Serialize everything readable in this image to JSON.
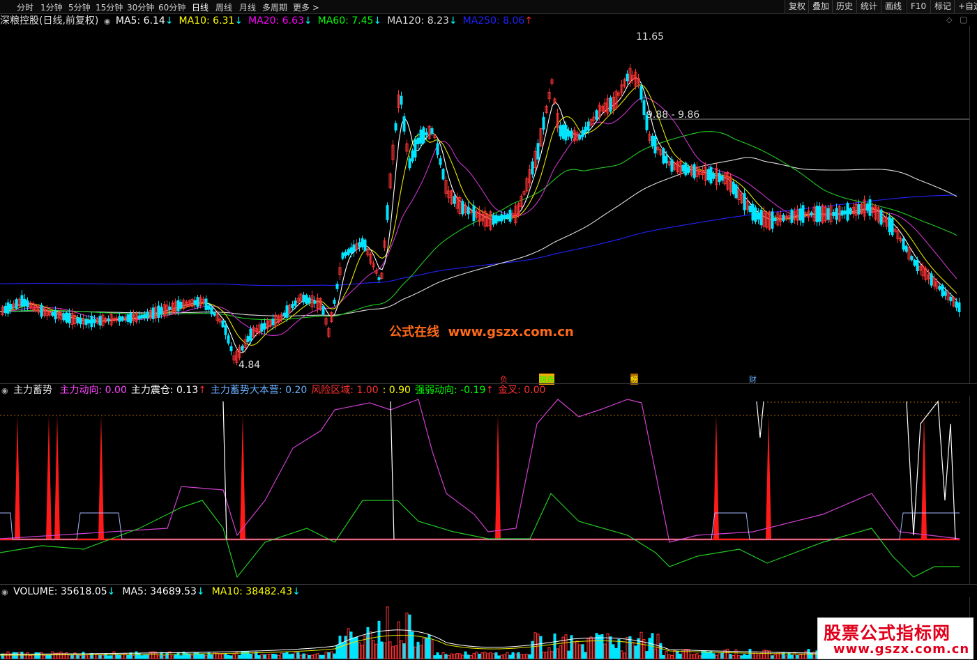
{
  "toolbar": {
    "timeframes": [
      "分时",
      "1分钟",
      "5分钟",
      "15分钟",
      "30分钟",
      "60分钟",
      "日线",
      "周线",
      "月线",
      "多周期",
      "更多 >"
    ],
    "active": "日线",
    "right_buttons": [
      "复权",
      "叠加",
      "历史",
      "统计",
      "画线",
      "F10",
      "标记",
      "+自选"
    ]
  },
  "main_panel": {
    "title": "深粮控股(日线,前复权)",
    "ma": [
      {
        "label": "MA5: 6.14",
        "arrow": "↓",
        "color": "#ffffff",
        "arrow_color": "#00ffff"
      },
      {
        "label": "MA10: 6.31",
        "arrow": "↓",
        "color": "#ffff00",
        "arrow_color": "#00ffff"
      },
      {
        "label": "MA20: 6.63",
        "arrow": "↓",
        "color": "#ff00ff",
        "arrow_color": "#00ffff"
      },
      {
        "label": "MA60: 7.45",
        "arrow": "↓",
        "color": "#00ff00",
        "arrow_color": "#00ffff"
      },
      {
        "label": "MA120: 8.23",
        "arrow": "↓",
        "color": "#dddddd",
        "arrow_color": "#00ffff"
      },
      {
        "label": "MA250: 8.06",
        "arrow": "↑",
        "color": "#2020ff",
        "arrow_color": "#ff3030"
      }
    ],
    "annotations": {
      "high": "11.65",
      "low": "4.84",
      "level": "9.88 - 9.86"
    },
    "watermark": "公式在线  www.gszx.com.cn",
    "event_markers": [
      {
        "text": "负",
        "color": "#ff3030"
      },
      {
        "text": "翅跌",
        "color": "#00ff00"
      },
      {
        "text": "榜",
        "color": "#ffff00"
      },
      {
        "text": "财",
        "color": "#6ab0ff"
      }
    ]
  },
  "indicator_panel": {
    "title": "主力蓄势",
    "items": [
      {
        "label": "主力动向: 0.00",
        "color": "#ff44ff"
      },
      {
        "label": "主力震仓: 0.13",
        "color": "#ffffff",
        "arrow": "↑",
        "arrow_color": "#ff3030"
      },
      {
        "label": "主力蓄势大本营: 0.20",
        "color": "#6ab0ff"
      },
      {
        "label": "风险区域: 1.00",
        "color": "#ff3030"
      },
      {
        "label": ": 0.90",
        "color": "#ffff00"
      },
      {
        "label": "强弱动向: -0.19",
        "color": "#00ff00",
        "arrow": "↑",
        "arrow_color": "#ff3030"
      },
      {
        "label": "金叉: 0.00",
        "color": "#ff3030"
      }
    ]
  },
  "volume_panel": {
    "items": [
      {
        "label": "VOLUME: 35618.05",
        "color": "#ffffff",
        "arrow": "↓",
        "arrow_color": "#00ffff"
      },
      {
        "label": "MA5: 34689.53",
        "color": "#ffffff",
        "arrow": "↓",
        "arrow_color": "#00ffff"
      },
      {
        "label": "MA10: 38482.43",
        "color": "#ffff00",
        "arrow": "↓",
        "arrow_color": "#00ffff"
      }
    ]
  },
  "badge": {
    "title": "股票公式指标网",
    "url": "www.gszx.com.cn"
  }
}
